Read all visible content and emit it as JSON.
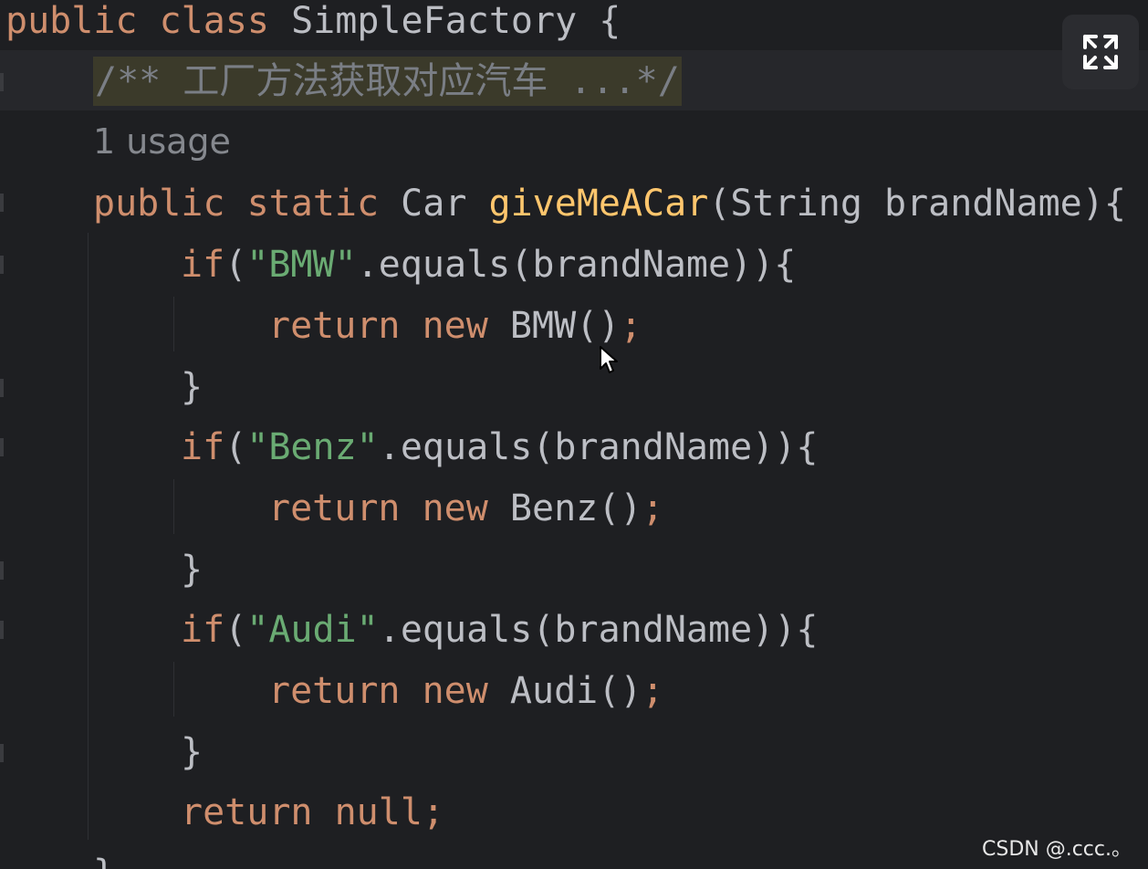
{
  "editor": {
    "lines": [
      [
        {
          "t": "public",
          "c": "kw"
        },
        {
          "t": " ",
          "c": "plain"
        },
        {
          "t": "class",
          "c": "kw"
        },
        {
          "t": " SimpleFactory {",
          "c": "plain"
        }
      ],
      [
        {
          "t": "/** 工厂方法获取对应汽车 ...*/",
          "c": "cmt doc-hl"
        }
      ],
      [
        {
          "t": "1 usage",
          "c": "hint"
        }
      ],
      [
        {
          "t": "public",
          "c": "kw"
        },
        {
          "t": " ",
          "c": "plain"
        },
        {
          "t": "static",
          "c": "kw"
        },
        {
          "t": " Car ",
          "c": "plain"
        },
        {
          "t": "giveMeACar",
          "c": "mth"
        },
        {
          "t": "(String brandName){",
          "c": "plain"
        }
      ],
      [
        {
          "t": "if",
          "c": "kw"
        },
        {
          "t": "(",
          "c": "plain"
        },
        {
          "t": "\"BMW\"",
          "c": "str"
        },
        {
          "t": ".equals(brandName)){",
          "c": "plain"
        }
      ],
      [
        {
          "t": "return",
          "c": "kw"
        },
        {
          "t": " ",
          "c": "plain"
        },
        {
          "t": "new",
          "c": "kw"
        },
        {
          "t": " BMW()",
          "c": "plain"
        },
        {
          "t": ";",
          "c": "kw"
        }
      ],
      [
        {
          "t": "}",
          "c": "plain"
        }
      ],
      [
        {
          "t": "if",
          "c": "kw"
        },
        {
          "t": "(",
          "c": "plain"
        },
        {
          "t": "\"Benz\"",
          "c": "str"
        },
        {
          "t": ".equals(brandName)){",
          "c": "plain"
        }
      ],
      [
        {
          "t": "return",
          "c": "kw"
        },
        {
          "t": " ",
          "c": "plain"
        },
        {
          "t": "new",
          "c": "kw"
        },
        {
          "t": " Benz()",
          "c": "plain"
        },
        {
          "t": ";",
          "c": "kw"
        }
      ],
      [
        {
          "t": "}",
          "c": "plain"
        }
      ],
      [
        {
          "t": "if",
          "c": "kw"
        },
        {
          "t": "(",
          "c": "plain"
        },
        {
          "t": "\"Audi\"",
          "c": "str"
        },
        {
          "t": ".equals(brandName)){",
          "c": "plain"
        }
      ],
      [
        {
          "t": "return",
          "c": "kw"
        },
        {
          "t": " ",
          "c": "plain"
        },
        {
          "t": "new",
          "c": "kw"
        },
        {
          "t": " Audi()",
          "c": "plain"
        },
        {
          "t": ";",
          "c": "kw"
        }
      ],
      [
        {
          "t": "}",
          "c": "plain"
        }
      ],
      [
        {
          "t": "return",
          "c": "kw"
        },
        {
          "t": " ",
          "c": "plain"
        },
        {
          "t": "null",
          "c": "kw"
        },
        {
          "t": ";",
          "c": "kw"
        }
      ],
      [
        {
          "t": "}",
          "c": "plain"
        }
      ]
    ]
  },
  "toolbar": {
    "expand_icon": "expand-icon"
  },
  "watermark": {
    "text": "CSDN @.ccc.。"
  },
  "colors": {
    "background": "#1e1f22",
    "keyword": "#cf8e6d",
    "string": "#6aab73",
    "method": "#ffc66d",
    "text": "#bcbec4",
    "comment": "#7a7e85"
  }
}
